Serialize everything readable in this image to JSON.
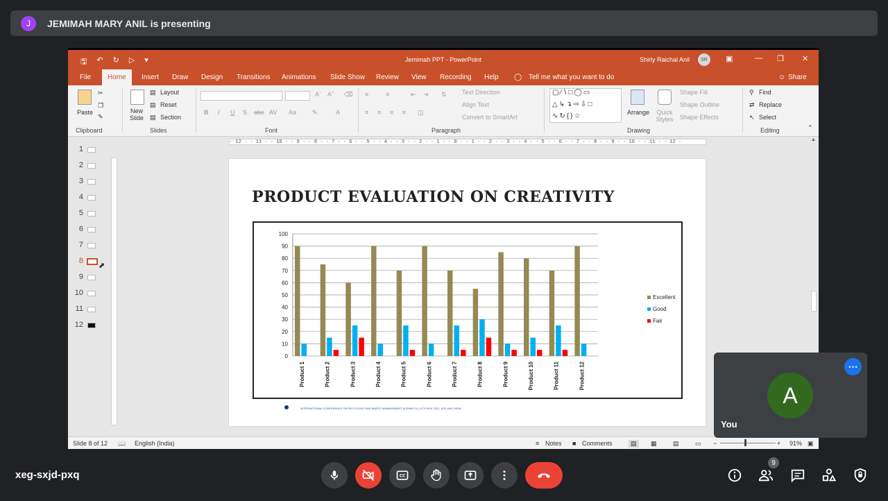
{
  "meet": {
    "presenter_initial": "J",
    "presenter_banner": "JEMIMAH MARY ANIL is presenting",
    "meeting_code": "xeg-sxjd-pxq",
    "self_initial": "A",
    "self_label": "You",
    "participants_count": "9",
    "colors": {
      "leave": "#ea4335",
      "camera_off": "#ea4335",
      "self_avatar": "#33691e",
      "presenter_avatar": "#a142f4",
      "accent": "#1a73e8"
    },
    "controls": [
      "mic-icon",
      "camera-off-icon",
      "captions-icon",
      "raise-hand-icon",
      "present-icon",
      "more-options-icon",
      "leave-call-icon"
    ],
    "right_controls": [
      "info-icon",
      "people-icon",
      "chat-icon",
      "activities-icon",
      "host-controls-icon"
    ]
  },
  "ppt": {
    "window_title": "Jemimah PPT  -  PowerPoint",
    "user_name": "Shirly Raichal Anil",
    "user_initials": "SR",
    "tabs": [
      "File",
      "Home",
      "Insert",
      "Draw",
      "Design",
      "Transitions",
      "Animations",
      "Slide Show",
      "Review",
      "View",
      "Recording",
      "Help"
    ],
    "tell_me": "Tell me what you want to do",
    "share": "Share",
    "ribbon": {
      "clipboard": {
        "paste": "Paste",
        "label": "Clipboard"
      },
      "slides": {
        "new_slide": "New Slide",
        "layout": "Layout",
        "reset": "Reset",
        "section": "Section",
        "label": "Slides"
      },
      "font": {
        "label": "Font"
      },
      "paragraph": {
        "text_direction": "Text Direction",
        "align_text": "Align Text",
        "convert": "Convert to SmartArt",
        "label": "Paragraph"
      },
      "drawing": {
        "arrange": "Arrange",
        "quick_styles": "Quick Styles",
        "shape_fill": "Shape Fill",
        "shape_outline": "Shape Outline",
        "shape_effects": "Shape Effects",
        "label": "Drawing"
      },
      "editing": {
        "find": "Find",
        "replace": "Replace",
        "select": "Select",
        "label": "Editing"
      }
    },
    "ruler_text": "· 12 · · 11 · · 10 · · 9 · · 8 · · 7 · · 6 · · 5 · · 4 · · 3 · · 2 · · 1 · · 0 · · 1 · · 2 · · 3 · · 4 · · 5 · · 6 · · 7 · · 8 · · 9 · · 10 · · 11 · · 12 ·",
    "thumbnails": [
      "1",
      "2",
      "3",
      "4",
      "5",
      "6",
      "7",
      "8",
      "9",
      "10",
      "11",
      "12"
    ],
    "active_slide": 8,
    "status": {
      "slide": "Slide 8 of 12",
      "language": "English (India)",
      "notes": "Notes",
      "comments": "Comments",
      "zoom": "91%"
    }
  },
  "slide": {
    "title": "PRODUCT EVALUATION ON CREATIVITY",
    "footer": "INTERNATIONAL CONFERENCE ON RECYCLING AND WASTE MANAGEMENT (ICRWM 21) 14TH NOV 2021, KOLLAM, INDIA"
  },
  "chart_data": {
    "type": "bar",
    "categories": [
      "Product 1",
      "Product 2",
      "Product 3",
      "Product 4",
      "Product 5",
      "Product 6",
      "Product 7",
      "Product 8",
      "Product 9",
      "Product 10",
      "Product 11",
      "Product 12"
    ],
    "series": [
      {
        "name": "Excellent",
        "color": "#948a54",
        "values": [
          90,
          75,
          60,
          90,
          70,
          90,
          70,
          55,
          85,
          80,
          70,
          90
        ]
      },
      {
        "name": "Good",
        "color": "#00b0f0",
        "values": [
          10,
          15,
          25,
          10,
          25,
          10,
          25,
          30,
          10,
          15,
          25,
          10
        ]
      },
      {
        "name": "Fair",
        "color": "#ff0000",
        "values": [
          0,
          5,
          15,
          0,
          5,
          0,
          5,
          15,
          5,
          5,
          5,
          0
        ]
      }
    ],
    "yticks": [
      "0",
      "10",
      "20",
      "30",
      "40",
      "50",
      "60",
      "70",
      "80",
      "90",
      "100"
    ],
    "ylim": [
      0,
      100
    ],
    "grid": true,
    "legend": "right"
  }
}
